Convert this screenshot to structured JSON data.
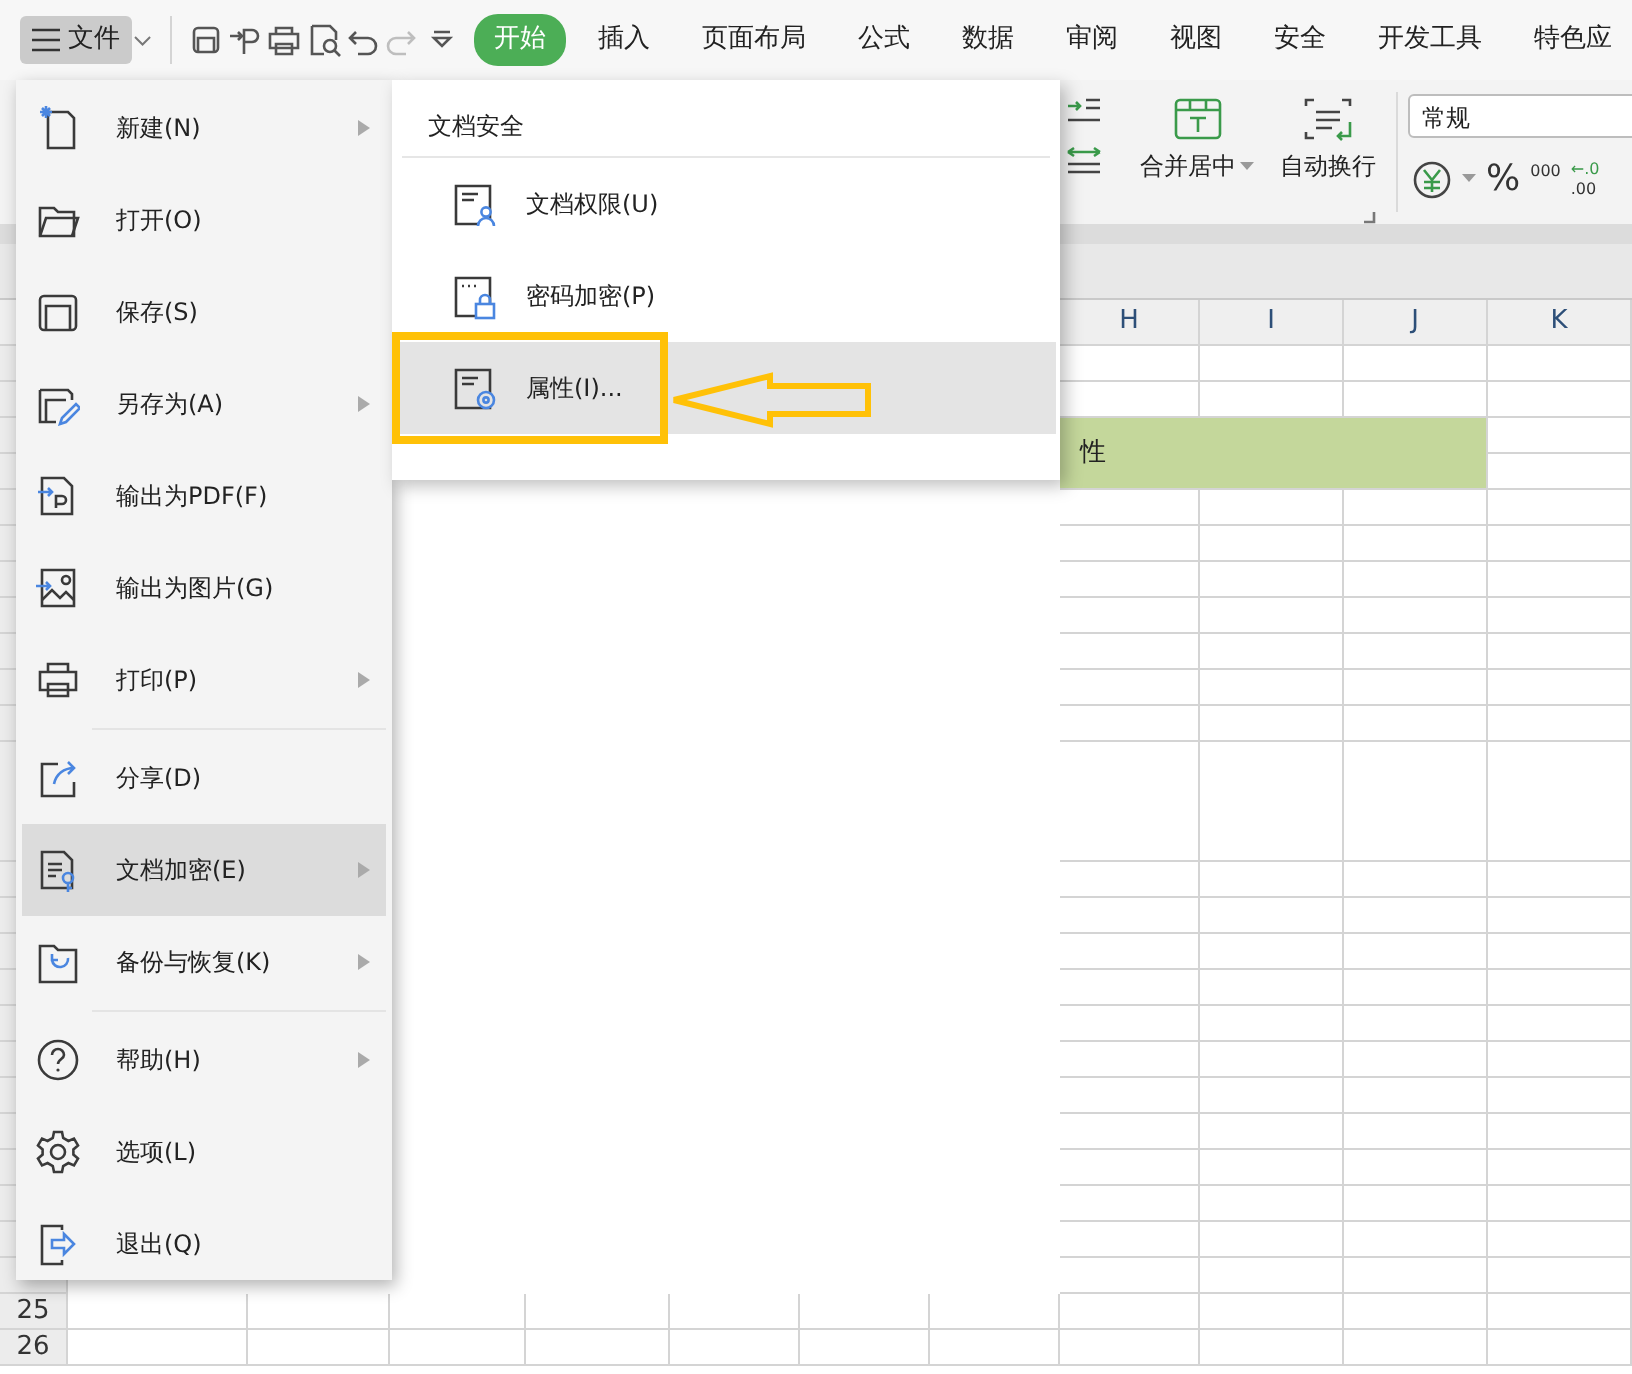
{
  "file_button": {
    "label": "文件"
  },
  "quick_tools": [
    {
      "kind": "save",
      "disabled": false
    },
    {
      "kind": "export",
      "disabled": false
    },
    {
      "kind": "print",
      "disabled": false
    },
    {
      "kind": "preview",
      "disabled": false
    },
    {
      "kind": "undo",
      "disabled": false
    },
    {
      "kind": "redo",
      "disabled": true
    },
    {
      "kind": "customize",
      "disabled": false
    }
  ],
  "tabs": [
    {
      "label": "开始",
      "selected": true
    },
    {
      "label": "插入",
      "selected": false
    },
    {
      "label": "页面布局",
      "selected": false
    },
    {
      "label": "公式",
      "selected": false
    },
    {
      "label": "数据",
      "selected": false
    },
    {
      "label": "审阅",
      "selected": false
    },
    {
      "label": "视图",
      "selected": false
    },
    {
      "label": "安全",
      "selected": false
    },
    {
      "label": "开发工具",
      "selected": false
    },
    {
      "label": "特色应",
      "selected": false
    }
  ],
  "ribbon": {
    "merge_label": "合并居中",
    "wrap_label": "自动换行",
    "number_format": "常规",
    "percent": "%",
    "thousands": "000",
    "decimal_top": "←.0",
    "decimal": ".00"
  },
  "sheet": {
    "columns": [
      "H",
      "I",
      "J",
      "K"
    ],
    "cell_text": "性",
    "row_numbers": [
      "25",
      "26"
    ]
  },
  "file_menu": {
    "items": [
      {
        "kind": "new",
        "label": "新建(N)",
        "submenu": true,
        "selected": false
      },
      {
        "kind": "open",
        "label": "打开(O)",
        "submenu": false,
        "selected": false
      },
      {
        "kind": "save",
        "label": "保存(S)",
        "submenu": false,
        "selected": false
      },
      {
        "kind": "saveas",
        "label": "另存为(A)",
        "submenu": true,
        "selected": false
      },
      {
        "kind": "pdf",
        "label": "输出为PDF(F)",
        "submenu": false,
        "selected": false
      },
      {
        "kind": "image",
        "label": "输出为图片(G)",
        "submenu": false,
        "selected": false
      },
      {
        "kind": "print",
        "label": "打印(P)",
        "submenu": true,
        "selected": false
      },
      {
        "kind": "separator"
      },
      {
        "kind": "share",
        "label": "分享(D)",
        "submenu": false,
        "selected": false
      },
      {
        "kind": "encrypt",
        "label": "文档加密(E)",
        "submenu": true,
        "selected": true
      },
      {
        "kind": "backup",
        "label": "备份与恢复(K)",
        "submenu": true,
        "selected": false
      },
      {
        "kind": "separator"
      },
      {
        "kind": "help",
        "label": "帮助(H)",
        "submenu": true,
        "selected": false
      },
      {
        "kind": "options",
        "label": "选项(L)",
        "submenu": false,
        "selected": false
      },
      {
        "kind": "exit",
        "label": "退出(Q)",
        "submenu": false,
        "selected": false
      }
    ]
  },
  "submenu": {
    "title": "文档安全",
    "items": [
      {
        "kind": "permission",
        "label": "文档权限(U)",
        "selected": false
      },
      {
        "kind": "password",
        "label": "密码加密(P)",
        "selected": false
      },
      {
        "kind": "properties",
        "label": "属性(I)...",
        "selected": true
      }
    ]
  }
}
